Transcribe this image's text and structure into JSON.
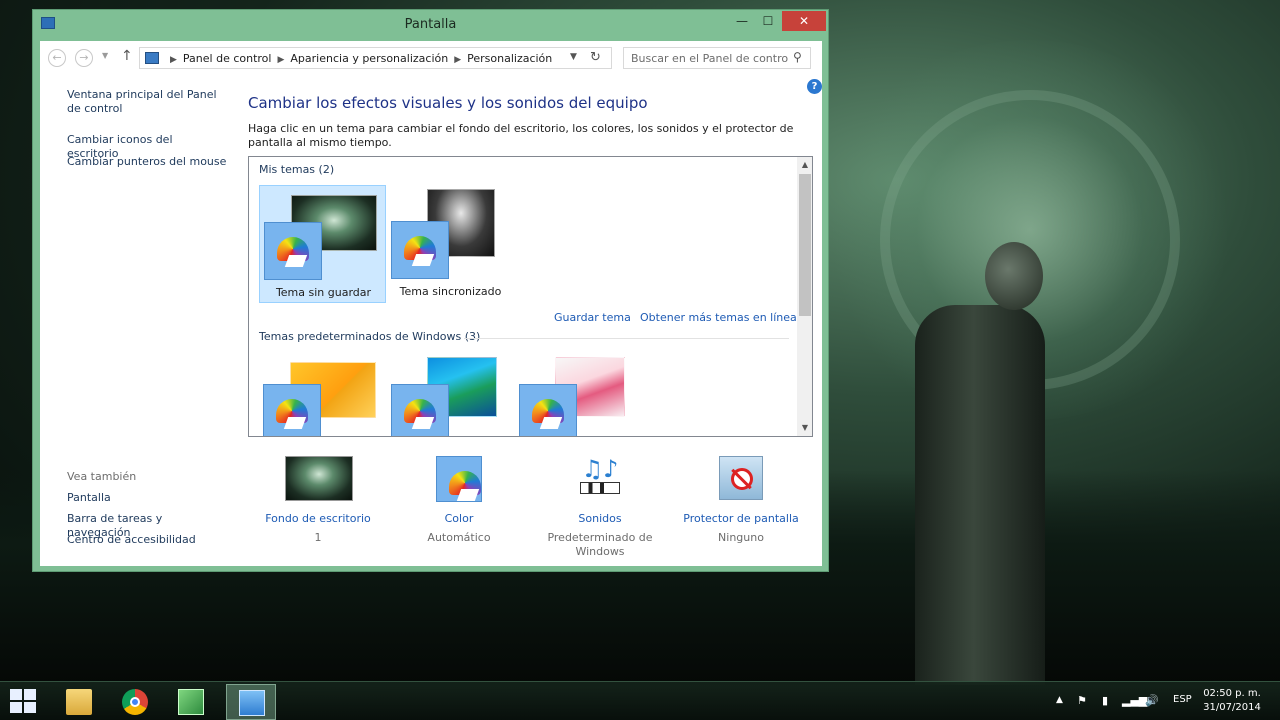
{
  "window": {
    "title": "Pantalla",
    "controls": {
      "minimize": "—",
      "maximize": "☐",
      "close": "✕"
    }
  },
  "address_bar": {
    "crumbs": [
      "Panel de control",
      "Apariencia y personalización",
      "Personalización"
    ],
    "search_placeholder": "Buscar en el Panel de control"
  },
  "sidebar": {
    "links": [
      "Ventana principal del Panel de control",
      "Cambiar iconos del escritorio",
      "Cambiar punteros del mouse"
    ],
    "see_also_heading": "Vea también",
    "see_also": [
      "Pantalla",
      "Barra de tareas y navegación",
      "Centro de accesibilidad"
    ]
  },
  "main": {
    "heading": "Cambiar los efectos visuales y los sonidos del equipo",
    "description": "Haga clic en un tema para cambiar el fondo del escritorio, los colores, los sonidos y el protector de pantalla al mismo tiempo.",
    "my_themes": {
      "label": "Mis temas (2)",
      "themes": [
        {
          "name": "Tema sin guardar",
          "selected": true
        },
        {
          "name": "Tema sincronizado",
          "selected": false
        }
      ],
      "links": [
        "Guardar tema",
        "Obtener más temas en línea"
      ]
    },
    "default_themes": {
      "label": "Temas predeterminados de Windows (3)"
    }
  },
  "settings": [
    {
      "label": "Fondo de escritorio",
      "value": "1",
      "icon": "desktop-background-icon"
    },
    {
      "label": "Color",
      "value": "Automático",
      "icon": "color-icon"
    },
    {
      "label": "Sonidos",
      "value": "Predeterminado de Windows",
      "icon": "sounds-icon"
    },
    {
      "label": "Protector de pantalla",
      "value": "Ninguno",
      "icon": "screensaver-icon"
    }
  ],
  "taskbar": {
    "apps": [
      "file-explorer-icon",
      "chrome-icon",
      "app-icon",
      "control-panel-icon"
    ],
    "language": "ESP",
    "time": "02:50 p. m.",
    "date": "31/07/2014"
  },
  "colors": {
    "window_frame": "#7fbf95",
    "link": "#1e5bb4",
    "heading": "#1e3287",
    "selection": "#cde8ff",
    "close_button": "#c7423a"
  }
}
